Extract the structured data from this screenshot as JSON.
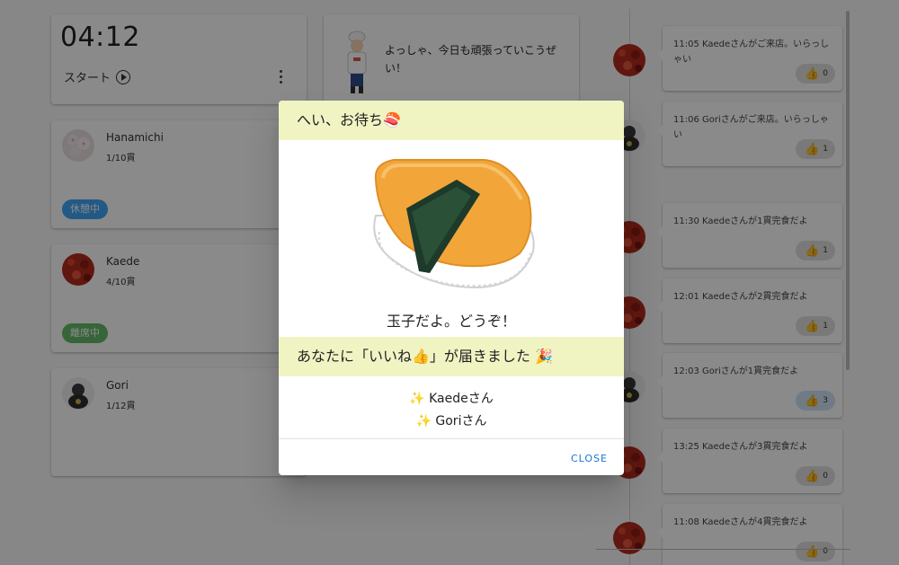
{
  "timer": {
    "time": "04:12",
    "start_label": "スタート"
  },
  "chef": {
    "message": "よっしゃ、今日も頑張っていこうぜい！"
  },
  "members": [
    {
      "name": "Hanamichi",
      "count": "1/10貫",
      "status": "休憩中",
      "status_color": "#42a5f5",
      "avatar": "flower"
    },
    {
      "name": "Kaede",
      "count": "4/10貫",
      "status": "離席中",
      "status_color": "#66bb6a",
      "avatar": "red-texture"
    },
    {
      "name": "Gori",
      "count": "1/12貫",
      "status": "",
      "status_color": "",
      "avatar": "gorilla"
    }
  ],
  "timeline": [
    {
      "text": "11:05 Kaedeさんがご来店。いらっしゃい",
      "likes": "0",
      "avatar": "red-texture",
      "liked": false
    },
    {
      "text": "11:06 Goriさんがご来店。いらっしゃい",
      "likes": "1",
      "avatar": "gorilla",
      "liked": false
    },
    {
      "text": "11:30 Kaedeさんが1貫完食だよ",
      "likes": "1",
      "avatar": "red-texture",
      "liked": false
    },
    {
      "text": "12:01 Kaedeさんが2貫完食だよ",
      "likes": "1",
      "avatar": "red-texture",
      "liked": false
    },
    {
      "text": "12:03 Goriさんが1貫完食だよ",
      "likes": "3",
      "avatar": "gorilla",
      "liked": true
    },
    {
      "text": "13:25 Kaedeさんが3貫完食だよ",
      "likes": "0",
      "avatar": "red-texture",
      "liked": false
    },
    {
      "text": "11:08 Kaedeさんが4貫完食だよ",
      "likes": "0",
      "avatar": "red-texture",
      "liked": false
    }
  ],
  "dialog": {
    "title": "へい、お待ち🍣",
    "dish": "玉子だよ。どうぞ！",
    "like_title": "あなたに「いいね👍」が届きました 🎉",
    "likers": [
      "✨ Kaedeさん",
      "✨ Goriさん"
    ],
    "close_label": "CLOSE"
  },
  "colors": {
    "accent": "#1976d2",
    "dialog_header_bg": "#f0f4c3",
    "like_active": "#cfe3f5"
  }
}
